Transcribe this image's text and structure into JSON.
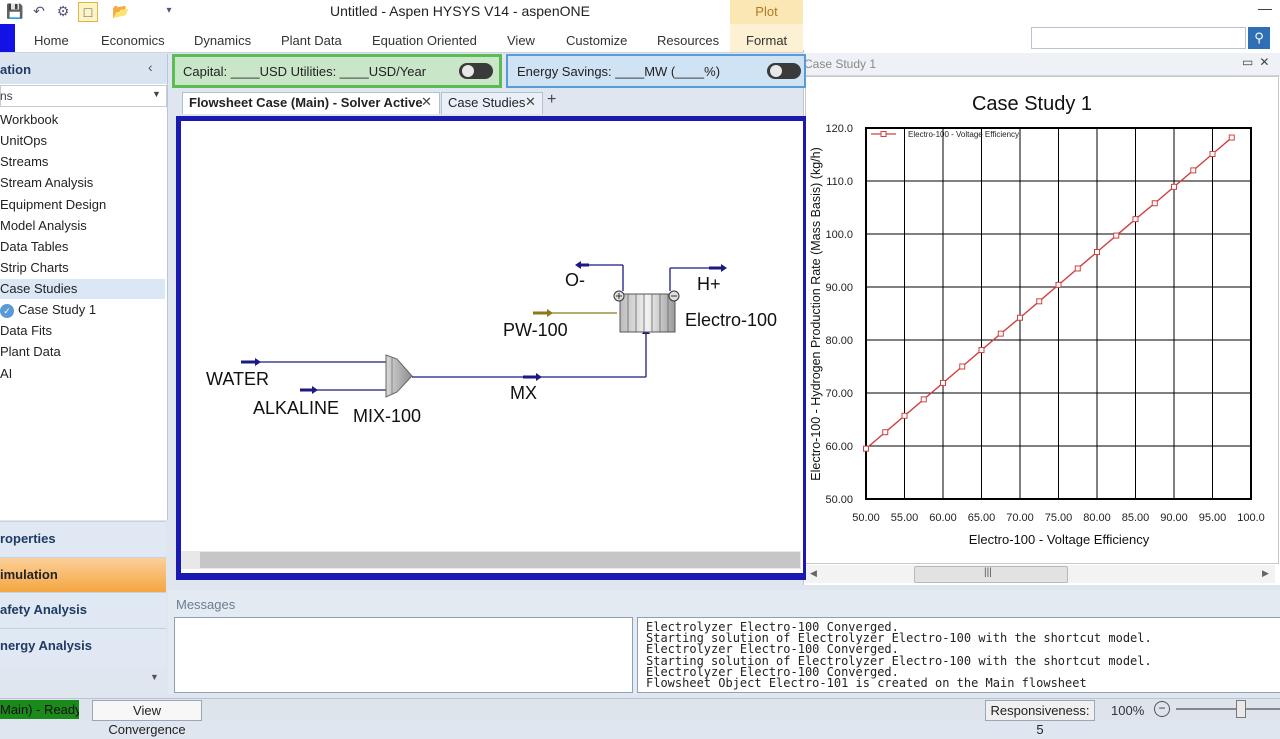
{
  "window": {
    "title": "Untitled - Aspen HYSYS V14 - aspenONE",
    "plot_context": "Plot"
  },
  "ribbon": {
    "tabs": [
      "Home",
      "Economics",
      "Dynamics",
      "Plant Data",
      "Equation Oriented",
      "View",
      "Customize",
      "Resources",
      "Format"
    ]
  },
  "nav": {
    "title": "ation",
    "combo_value": "ns",
    "items": [
      "Workbook",
      "UnitOps",
      "Streams",
      "Stream Analysis",
      "Equipment Design",
      "Model Analysis",
      "Data Tables",
      "Strip Charts",
      "Case Studies",
      "Case Study 1",
      "Data Fits",
      "Plant Data",
      "AI"
    ],
    "panels": [
      "roperties",
      "imulation",
      "afety Analysis",
      "nergy Analysis"
    ]
  },
  "summary": {
    "capital_text": "Capital: ____USD   Utilities: ____USD/Year",
    "energy_text": "Energy Savings: ____MW     (____%)"
  },
  "doc_tabs": {
    "main": "Flowsheet Case (Main) - Solver Active",
    "case_studies": "Case Studies"
  },
  "flowsheet": {
    "labels": {
      "water": "WATER",
      "alkaline": "ALKALINE",
      "mixer": "MIX-100",
      "mx": "MX",
      "pw": "PW-100",
      "o_minus": "O-",
      "h_plus": "H+",
      "electro": "Electro-100"
    },
    "colors": {
      "stream": "#1a1a80",
      "energy": "#8b7a1a",
      "unit": "#a8a8a8"
    }
  },
  "case_study_window": {
    "title": "Case Study 1"
  },
  "chart_data": {
    "type": "line",
    "title": "Case Study 1",
    "xlabel": "Electro-100 - Voltage Efficiency",
    "ylabel": "Electro-100 - Hydrogen Production Rate (Mass Basis) (kg/h)",
    "xlim": [
      50,
      100
    ],
    "ylim": [
      50,
      120
    ],
    "x_ticks": [
      "50.00",
      "55.00",
      "60.00",
      "65.00",
      "70.00",
      "75.00",
      "80.00",
      "85.00",
      "90.00",
      "95.00",
      "100.0"
    ],
    "y_ticks": [
      "50.00",
      "60.00",
      "70.00",
      "80.00",
      "90.00",
      "100.0",
      "110.0",
      "120.0"
    ],
    "grid": true,
    "legend": "top-left",
    "series": [
      {
        "name": "Electro-100 - Voltage Efficiency",
        "color": "#d04040",
        "x": [
          50.0,
          52.5,
          55.0,
          57.5,
          60.0,
          62.5,
          65.0,
          67.5,
          70.0,
          72.5,
          75.0,
          77.5,
          80.0,
          82.5,
          85.0,
          87.5,
          90.0,
          92.5,
          95.0,
          97.5
        ],
        "y": [
          59.5,
          62.6,
          65.7,
          68.8,
          71.9,
          75.0,
          78.1,
          81.2,
          84.2,
          87.3,
          90.4,
          93.5,
          96.6,
          99.7,
          102.8,
          105.8,
          108.9,
          112.0,
          115.1,
          118.2
        ]
      }
    ]
  },
  "messages": {
    "label": "Messages",
    "lines": [
      "Electrolyzer Electro-100 Converged.",
      "Starting solution of Electrolyzer Electro-100 with the shortcut model.",
      "Electrolyzer Electro-100 Converged.",
      "Starting solution of Electrolyzer Electro-100 with the shortcut model.",
      "Electrolyzer Electro-100 Converged.",
      "Flowsheet Object Electro-101 is created on the Main flowsheet"
    ]
  },
  "status": {
    "ready": "Main) - Ready",
    "view_convergence": "View Convergence",
    "responsiveness": "Responsiveness: 5",
    "zoom": "100%"
  }
}
